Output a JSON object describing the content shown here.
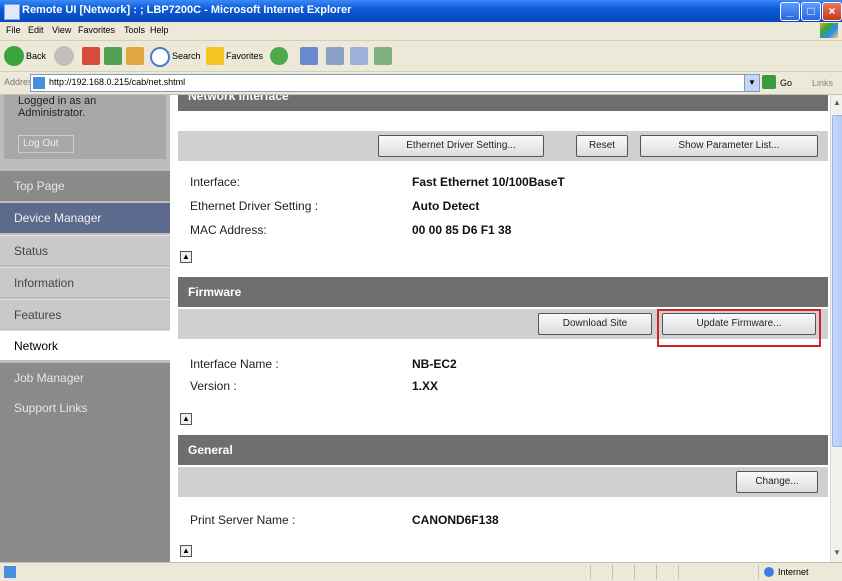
{
  "window": {
    "title": "Remote UI [Network] : ; LBP7200C - Microsoft Internet Explorer",
    "controls": [
      "minimize",
      "maximize",
      "close"
    ]
  },
  "menu": [
    "File",
    "Edit",
    "View",
    "Favorites",
    "Tools",
    "Help"
  ],
  "toolbar": {
    "back_label": "Back",
    "search_label": "Search",
    "favorites_label": "Favorites"
  },
  "address": {
    "label": "Address",
    "url": "http://192.168.0.215/cab/net.shtml",
    "go_label": "Go",
    "links_label": "Links"
  },
  "sidebar": {
    "logged_in_text": "Logged in as an Administrator.",
    "logout_label": "Log Out",
    "top_page": "Top Page",
    "device_manager": "Device Manager",
    "sub_items": [
      "Status",
      "Information",
      "Features",
      "Network"
    ],
    "job_manager": "Job Manager",
    "support_links": "Support Links",
    "active_item": "Network"
  },
  "network_interface": {
    "header": "Network Interface",
    "buttons": {
      "ethernet_driver": "Ethernet Driver Setting...",
      "reset": "Reset",
      "show_params": "Show Parameter List..."
    },
    "rows": [
      {
        "label": "Interface:",
        "value": "Fast Ethernet 10/100BaseT"
      },
      {
        "label": "Ethernet Driver Setting :",
        "value": "Auto Detect"
      },
      {
        "label": "MAC Address:",
        "value": "00 00 85 D6 F1 38"
      }
    ]
  },
  "firmware": {
    "header": "Firmware",
    "buttons": {
      "download": "Download Site",
      "update": "Update Firmware..."
    },
    "rows": [
      {
        "label": "Interface Name :",
        "value": "NB-EC2"
      },
      {
        "label": "Version :",
        "value": "1.XX"
      }
    ]
  },
  "general": {
    "header": "General",
    "buttons": {
      "change": "Change..."
    },
    "rows": [
      {
        "label": "Print Server Name :",
        "value": "CANOND6F138"
      }
    ]
  },
  "status": {
    "zone": "Internet"
  }
}
